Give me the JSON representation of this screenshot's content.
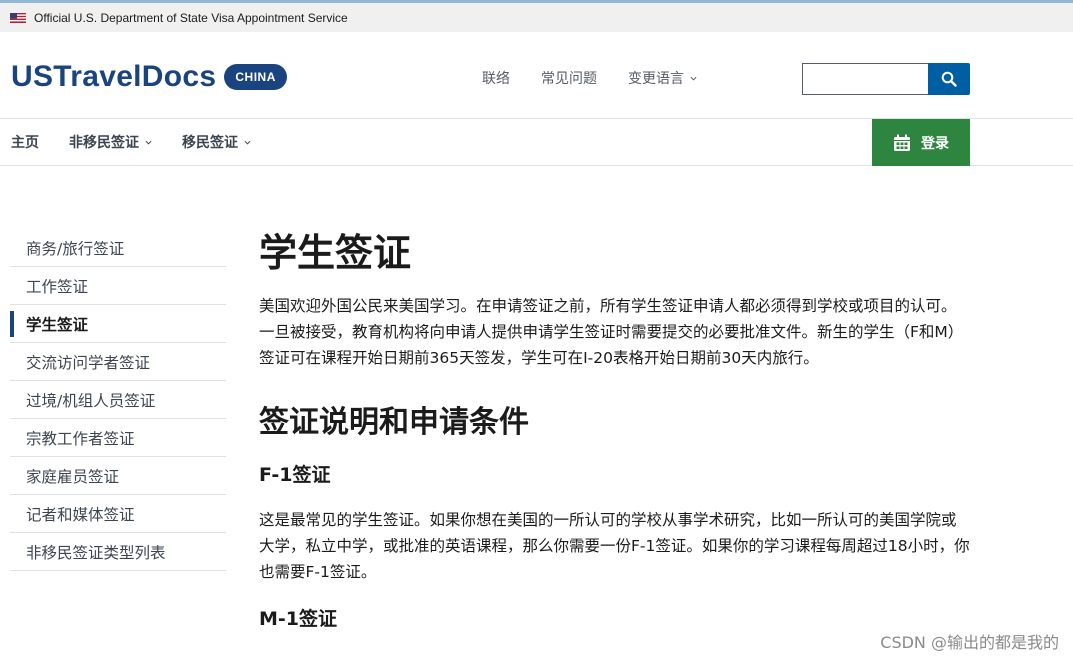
{
  "banner": {
    "text": "Official U.S. Department of State Visa Appointment Service"
  },
  "header": {
    "logo_text": "USTravelDocs",
    "logo_badge": "CHINA",
    "util_nav": [
      {
        "label": "联络",
        "has_dropdown": false
      },
      {
        "label": "常见问题",
        "has_dropdown": false
      },
      {
        "label": "变更语言",
        "has_dropdown": true
      }
    ],
    "search": {
      "value": "",
      "placeholder": "",
      "icon": "search-icon"
    }
  },
  "main_nav": {
    "items": [
      {
        "label": "主页",
        "has_dropdown": false
      },
      {
        "label": "非移民签证",
        "has_dropdown": true
      },
      {
        "label": "移民签证",
        "has_dropdown": true
      }
    ],
    "login_label": "登录",
    "login_icon": "calendar-icon"
  },
  "sidebar": {
    "items": [
      {
        "label": "商务/旅行签证",
        "active": false
      },
      {
        "label": "工作签证",
        "active": false
      },
      {
        "label": "学生签证",
        "active": true
      },
      {
        "label": "交流访问学者签证",
        "active": false
      },
      {
        "label": "过境/机组人员签证",
        "active": false
      },
      {
        "label": "宗教工作者签证",
        "active": false
      },
      {
        "label": "家庭雇员签证",
        "active": false
      },
      {
        "label": "记者和媒体签证",
        "active": false
      },
      {
        "label": "非移民签证类型列表",
        "active": false
      }
    ]
  },
  "content": {
    "title": "学生签证",
    "intro": "美国欢迎外国公民来美国学习。在申请签证之前，所有学生签证申请人都必须得到学校或项目的认可。一旦被接受，教育机构将向申请人提供申请学生签证时需要提交的必要批准文件。新生的学生（F和M）签证可在课程开始日期前365天签发，学生可在I-20表格开始日期前30天内旅行。",
    "section_heading": "签证说明和申请条件",
    "f1_heading": "F-1签证",
    "f1_text": "这是最常见的学生签证。如果你想在美国的一所认可的学校从事学术研究，比如一所认可的美国学院或大学，私立中学，或批准的英语课程，那么你需要一份F-1签证。如果你的学习课程每周超过18小时，你也需要F-1签证。",
    "m1_heading": "M-1签证"
  },
  "watermark": "CSDN @输出的都是我的",
  "colors": {
    "brand_blue": "#1a4480",
    "search_blue": "#005ea2",
    "login_green": "#2e8540",
    "banner_bg": "#f0f0f0"
  }
}
